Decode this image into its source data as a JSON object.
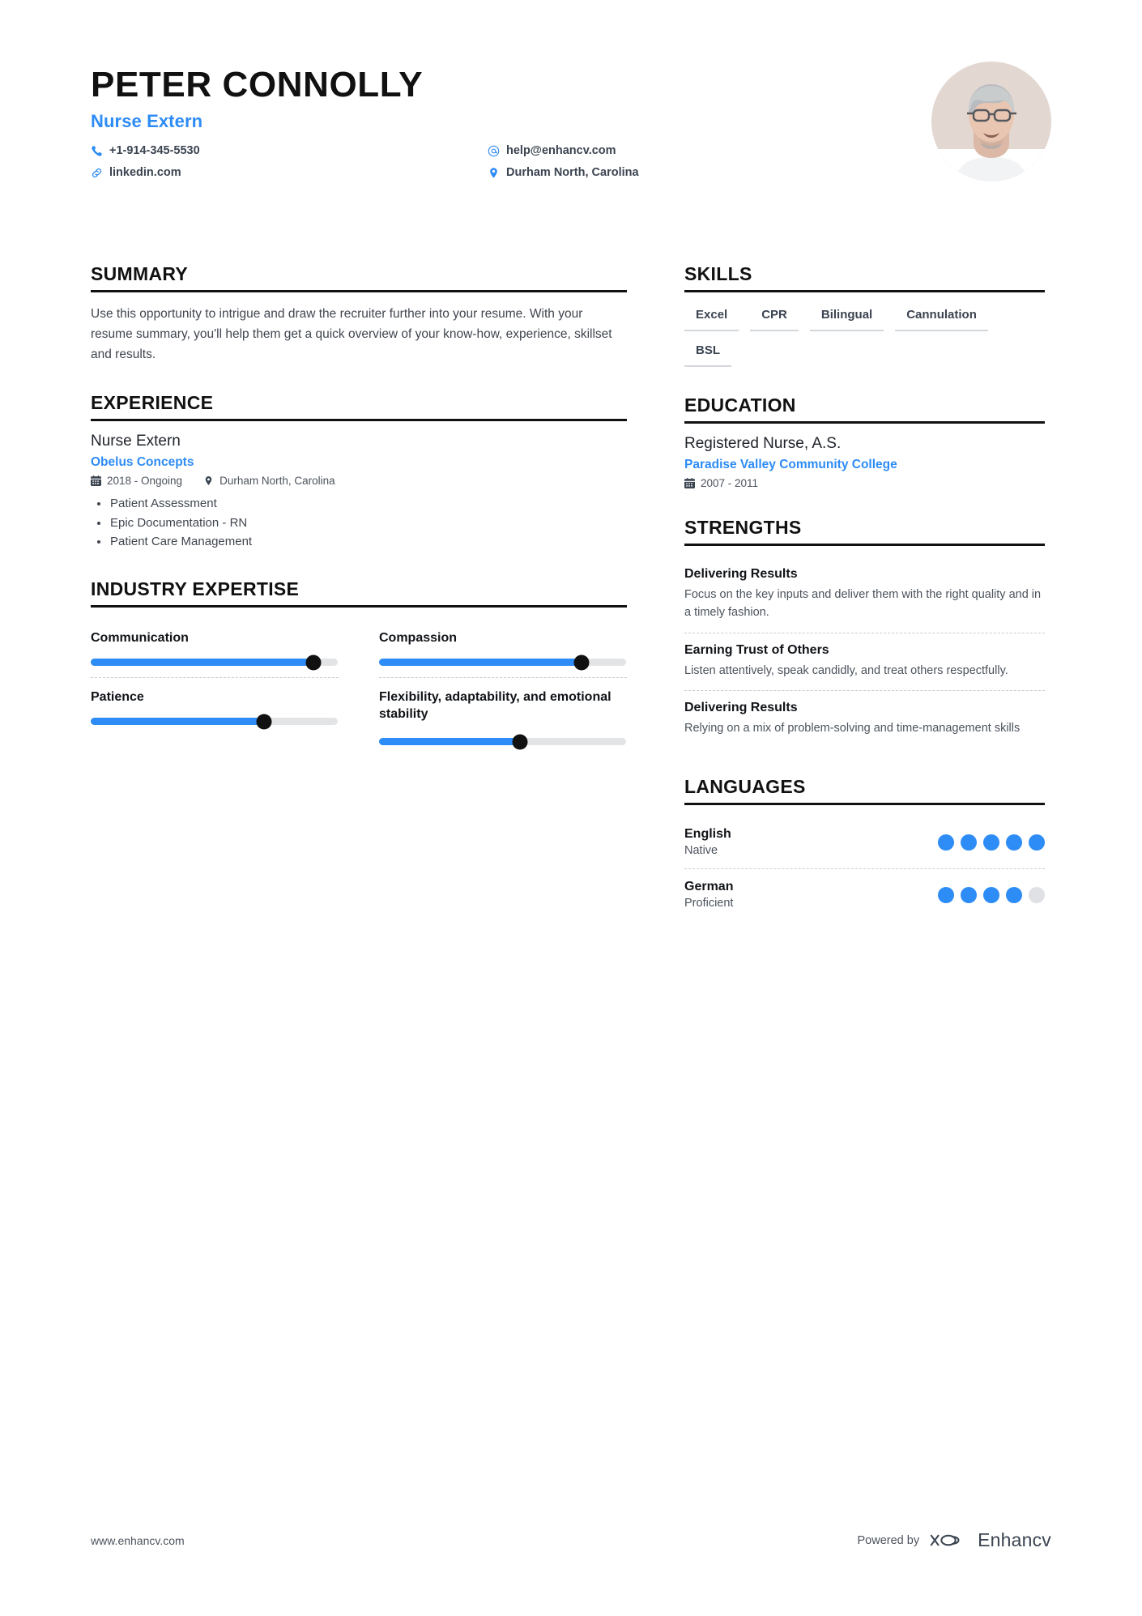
{
  "header": {
    "name": "PETER CONNOLLY",
    "role": "Nurse Extern",
    "contacts": [
      {
        "icon": "phone-icon",
        "text": "+1-914-345-5530"
      },
      {
        "icon": "email-icon",
        "text": "help@enhancv.com"
      },
      {
        "icon": "link-icon",
        "text": "linkedin.com"
      },
      {
        "icon": "location-icon",
        "text": "Durham North, Carolina"
      }
    ],
    "photo_alt": "profile-photo"
  },
  "summary": {
    "title": "SUMMARY",
    "text": "Use this opportunity to intrigue and draw the recruiter further into your resume. With your resume summary, you'll help them get a quick overview of your know-how, experience, skillset and results."
  },
  "experience": {
    "title": "EXPERIENCE",
    "jobs": [
      {
        "position": "Nurse Extern",
        "company": "Obelus Concepts",
        "dates": "2018 - Ongoing",
        "location": "Durham North, Carolina",
        "bullets": [
          "Patient Assessment",
          "Epic Documentation - RN",
          "Patient Care Management"
        ]
      }
    ]
  },
  "industry_expertise": {
    "title": "INDUSTRY EXPERTISE",
    "items": [
      {
        "label": "Communication",
        "value": 90
      },
      {
        "label": "Compassion",
        "value": 82
      },
      {
        "label": "Patience",
        "value": 70
      },
      {
        "label": "Flexibility, adaptability, and emotional stability",
        "value": 57
      }
    ]
  },
  "skills": {
    "title": "SKILLS",
    "items": [
      "Excel",
      "CPR",
      "Bilingual",
      "Cannulation",
      "BSL"
    ]
  },
  "education": {
    "title": "EDUCATION",
    "entries": [
      {
        "degree": "Registered Nurse, A.S.",
        "school": "Paradise Valley Community College",
        "dates": "2007 - 2011"
      }
    ]
  },
  "strengths": {
    "title": "STRENGTHS",
    "items": [
      {
        "name": "Delivering Results",
        "description": "Focus on the key inputs and deliver them with the right quality and in a timely fashion."
      },
      {
        "name": "Earning Trust of Others",
        "description": "Listen attentively, speak candidly, and treat others respectfully."
      },
      {
        "name": "Delivering Results",
        "description": "Relying on a mix of problem-solving and time-management skills"
      }
    ]
  },
  "languages": {
    "title": "LANGUAGES",
    "items": [
      {
        "name": "English",
        "level": "Native",
        "dots_filled": 5,
        "dots_total": 5
      },
      {
        "name": "German",
        "level": "Proficient",
        "dots_filled": 4,
        "dots_total": 5
      }
    ]
  },
  "footer": {
    "url": "www.enhancv.com",
    "powered_by": "Powered by",
    "brand": "Enhancv"
  },
  "colors": {
    "accent": "#2d8cf5",
    "ink": "#111111",
    "body": "#40464f",
    "track": "#e3e4e6",
    "dot_off": "#dfe1e4"
  }
}
